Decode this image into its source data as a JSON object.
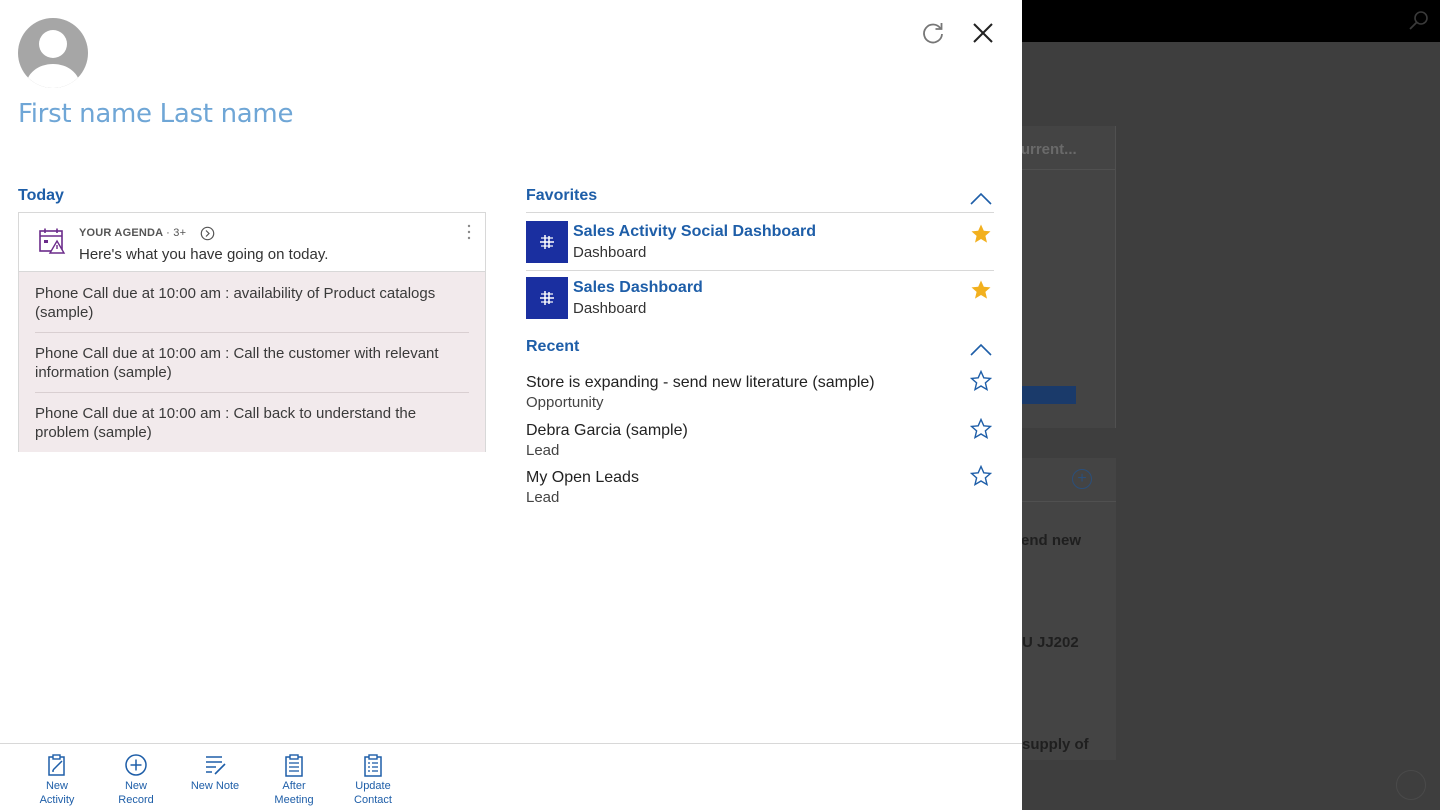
{
  "background": {
    "card1_title": "Current...",
    "card2_text1": "end new",
    "card2_text2": "U JJ202",
    "card2_text3": "supply of",
    "plus_glyph": "+"
  },
  "panel": {
    "user_name": "First name Last name",
    "icons": {
      "refresh": "refresh-icon",
      "close": "close-icon"
    }
  },
  "today": {
    "title": "Today",
    "agenda": {
      "label": "YOUR AGENDA",
      "count": "· 3+",
      "subtitle": "Here's what you have going on today.",
      "items": [
        "Phone Call due at 10:00 am : availability of Product catalogs (sample)",
        "Phone Call due at 10:00 am : Call the customer with relevant information (sample)",
        "Phone Call due at 10:00 am : Call back to understand the problem (sample)"
      ]
    }
  },
  "favorites": {
    "title": "Favorites",
    "items": [
      {
        "title": "Sales Activity Social Dashboard",
        "subtitle": "Dashboard"
      },
      {
        "title": "Sales Dashboard",
        "subtitle": "Dashboard"
      }
    ]
  },
  "recent": {
    "title": "Recent",
    "items": [
      {
        "title": "Store is expanding - send new literature (sample)",
        "subtitle": "Opportunity"
      },
      {
        "title": "Debra Garcia (sample)",
        "subtitle": "Lead"
      },
      {
        "title": "My Open Leads",
        "subtitle": "Lead"
      }
    ]
  },
  "actions": [
    {
      "label": "New\nActivity",
      "icon": "new-activity-icon"
    },
    {
      "label": "New\nRecord",
      "icon": "add-circle-icon"
    },
    {
      "label": "New Note",
      "icon": "note-icon"
    },
    {
      "label": "After\nMeeting",
      "icon": "clipboard-icon"
    },
    {
      "label": "Update\nContact",
      "icon": "clipboard-list-icon"
    }
  ],
  "colors": {
    "accent": "#1e5ea8",
    "name": "#6fa6d6",
    "star_filled": "#f2b01e",
    "tile": "#1a2fa0",
    "agenda_bg": "#f2eaec"
  }
}
